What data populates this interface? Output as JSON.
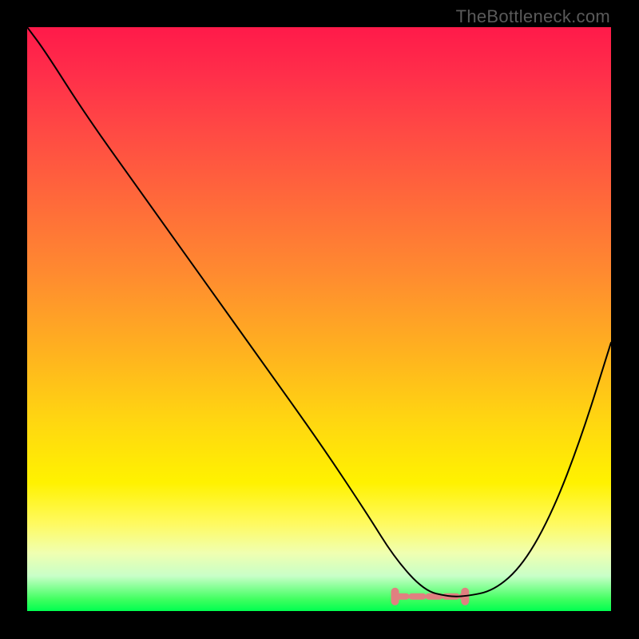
{
  "attribution": "TheBottleneck.com",
  "chart_data": {
    "type": "line",
    "title": "",
    "xlabel": "",
    "ylabel": "",
    "xlim": [
      0,
      100
    ],
    "ylim": [
      0,
      100
    ],
    "grid": false,
    "legend": "none",
    "background_gradient": {
      "top": "#ff1a4a",
      "middle": "#fff200",
      "bottom": "#00ff50"
    },
    "series": [
      {
        "name": "bottleneck-curve",
        "x": [
          0,
          3,
          10,
          20,
          30,
          40,
          50,
          58,
          63,
          68,
          72,
          75,
          80,
          85,
          90,
          95,
          100
        ],
        "values": [
          100,
          96,
          85,
          71,
          57,
          43,
          29,
          17,
          9,
          3.5,
          2.5,
          2.5,
          3.5,
          8,
          17,
          30,
          46
        ]
      },
      {
        "name": "flat-segment-marker",
        "x": [
          63,
          75
        ],
        "values": [
          2.5,
          2.5
        ]
      }
    ],
    "annotations": [],
    "colors": {
      "curve": "#000000",
      "marker": "#e08080"
    }
  }
}
